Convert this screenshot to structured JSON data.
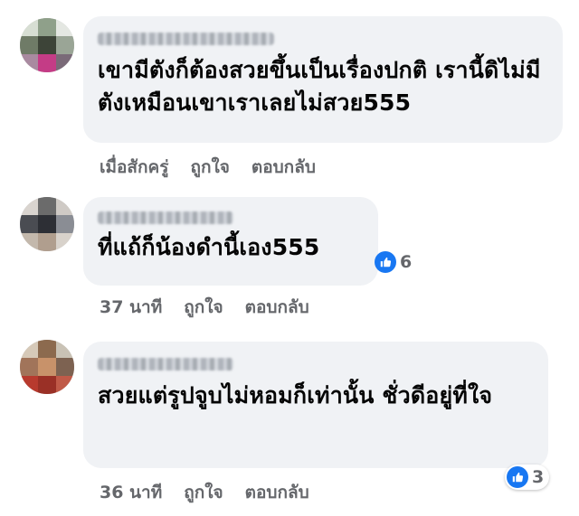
{
  "comments": [
    {
      "text": "เขามีตังก็ต้องสวยขึ้นเป็นเรื่องปกติ เรานี้ดิไม่มีตังเหมือนเขาเราเลยไม่สวย555",
      "time": "เมื่อสักครู่",
      "like_label": "ถูกใจ",
      "reply_label": "ตอบกลับ",
      "reactions": ""
    },
    {
      "text": "ที่แถ้ก็น้องดำนี้เอง555",
      "time": "37 นาที",
      "like_label": "ถูกใจ",
      "reply_label": "ตอบกลับ",
      "reactions": "6"
    },
    {
      "text": "สวยแต่รูปจูบไม่หอมก็เท่านั้น ชั่วดีอยู่ที่ใจ",
      "time": "36 นาที",
      "like_label": "ถูกใจ",
      "reply_label": "ตอบกลับ",
      "reactions": "3"
    }
  ],
  "icons": {
    "like": "thumbs-up-icon"
  },
  "colors": {
    "bubble": "#f0f2f5",
    "meta_text": "#65676b",
    "like_blue": "#1877f2"
  }
}
